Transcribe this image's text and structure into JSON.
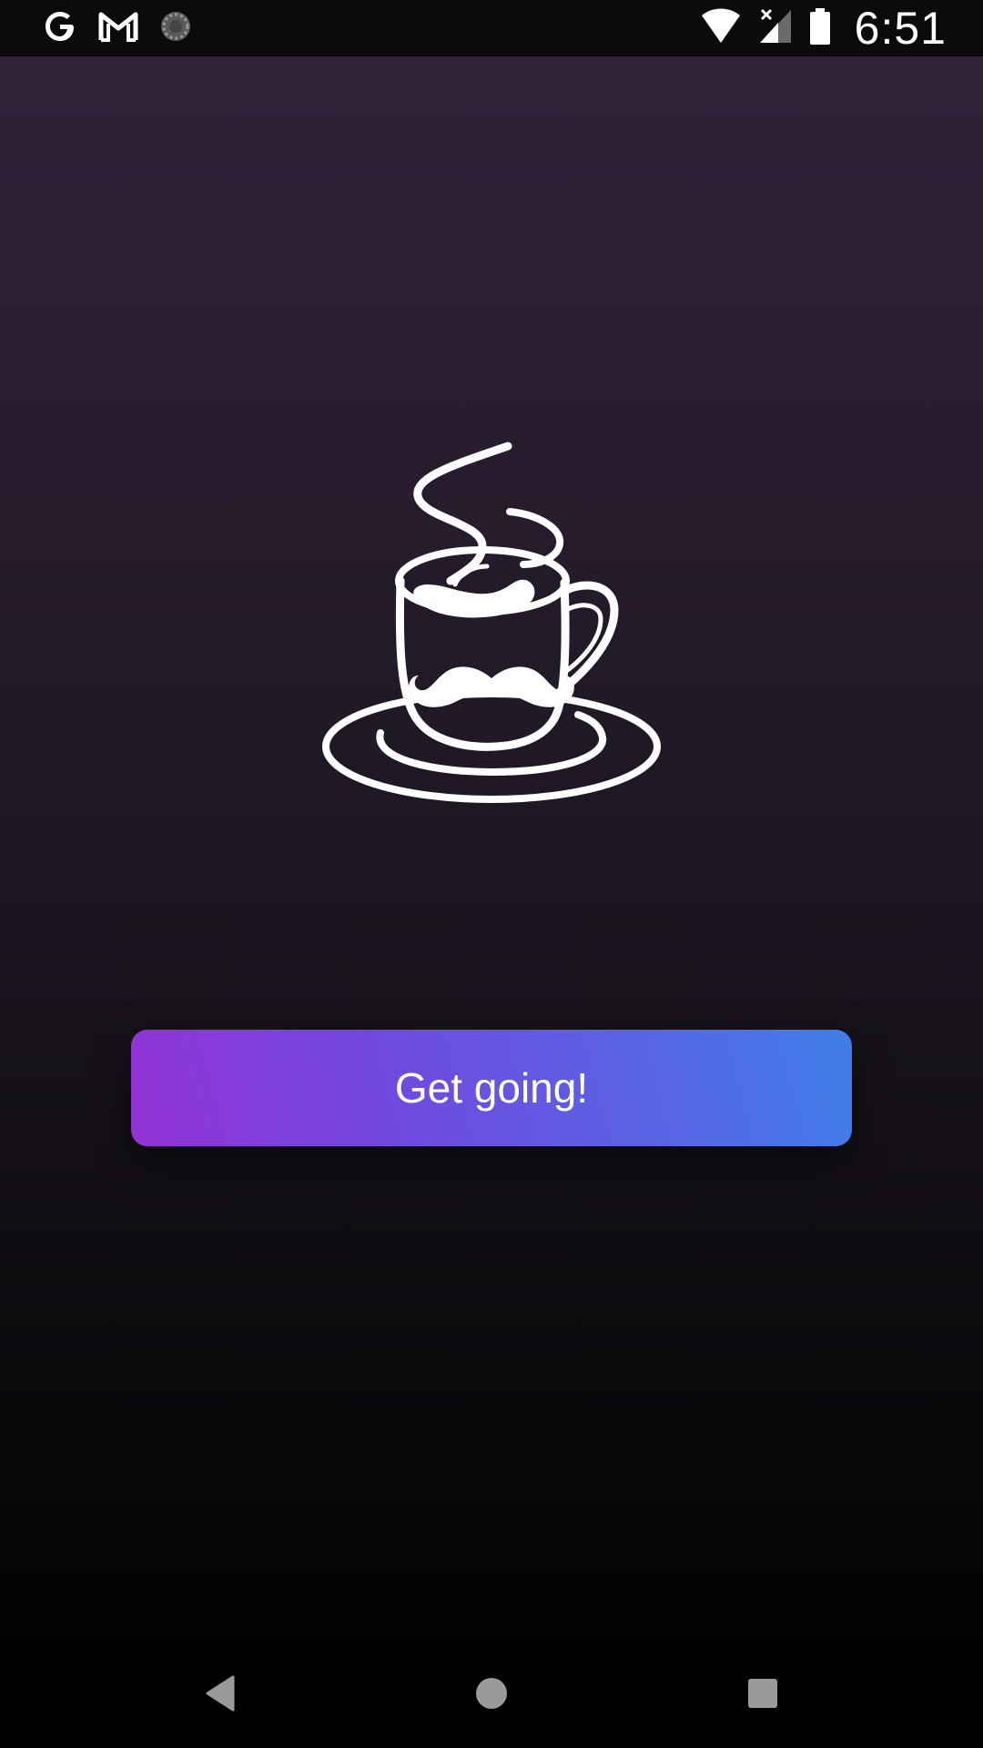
{
  "status_bar": {
    "time": "6:51",
    "left_icons": [
      "google-icon",
      "gmail-icon",
      "sync-spinner-icon"
    ],
    "right_icons": [
      "wifi-icon",
      "cellular-no-signal-icon",
      "battery-icon"
    ]
  },
  "main": {
    "logo_icon": "coffee-cup-mustache-icon",
    "cta_label": "Get going!"
  },
  "nav_bar": {
    "buttons": [
      "back-icon",
      "home-icon",
      "recents-icon"
    ]
  },
  "colors": {
    "background_top": "#31233a",
    "background_bottom": "#000000",
    "button_gradient_start": "#9433d6",
    "button_gradient_end": "#3f7ee9",
    "text": "#ffffff"
  }
}
